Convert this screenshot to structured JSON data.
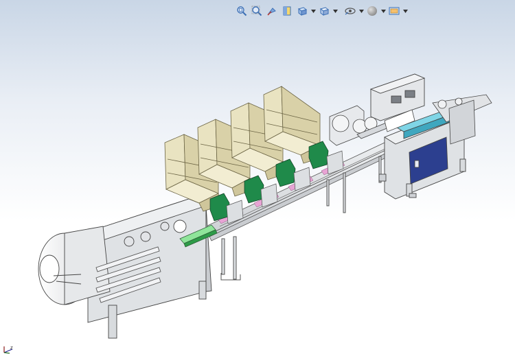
{
  "toolbar": {
    "buttons": [
      {
        "name": "zoom-to-fit-button",
        "icon": "zoom-fit-icon"
      },
      {
        "name": "zoom-to-area-button",
        "icon": "zoom-area-icon"
      },
      {
        "name": "previous-view-button",
        "icon": "previous-view-icon"
      },
      {
        "name": "section-view-button",
        "icon": "section-view-icon"
      },
      {
        "name": "view-orientation-button",
        "icon": "view-orientation-icon",
        "dropdown": true
      },
      {
        "name": "display-style-button",
        "icon": "display-style-icon",
        "dropdown": true
      },
      {
        "name": "hide-show-items-button",
        "icon": "hide-show-icon",
        "dropdown": true
      },
      {
        "name": "edit-appearance-button",
        "icon": "appearance-sphere-icon",
        "dropdown": true
      },
      {
        "name": "view-settings-button",
        "icon": "view-settings-icon",
        "dropdown": true
      }
    ],
    "icon_color": "#3b6fb5"
  },
  "viewport": {
    "background_top": "#c9d6e6",
    "background_bottom": "#ffffff",
    "triad_label": "z"
  },
  "model": {
    "body_color": "#dfe1e4",
    "hopper_color": "#e9e3c1",
    "green_color": "#1f8a4a",
    "panel_color": "#2c3f8f",
    "accent_pink": "#e8a3d4",
    "accent_cyan": "#7fd5e6"
  }
}
